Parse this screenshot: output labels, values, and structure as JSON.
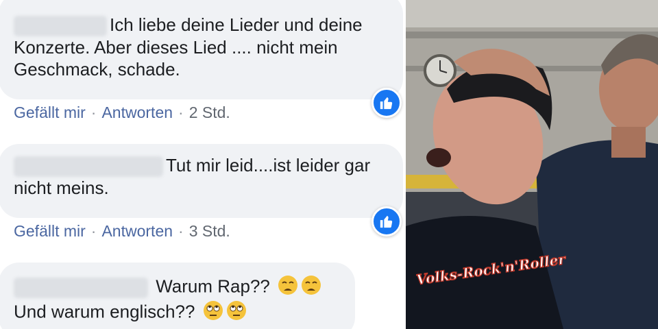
{
  "comments": [
    {
      "text_line1": "Ich liebe deine Lieder und deine",
      "text_line2": "Konzerte. Aber dieses Lied .... nicht mein",
      "text_line3": "Geschmack, schade."
    },
    {
      "text_line1": "Tut mir leid....ist leider gar",
      "text_line2": "nicht meins."
    },
    {
      "text_line1": "Warum Rap??",
      "text_line2": "Und warum englisch??"
    }
  ],
  "actions": [
    {
      "like": "Gefällt mir",
      "reply": "Antworten",
      "time": "2 Std."
    },
    {
      "like": "Gefällt mir",
      "reply": "Antworten",
      "time": "3 Std."
    }
  ],
  "shirt_print": "Volks-Rock'n'Roller",
  "colors": {
    "link": "#4b67a1",
    "bubble": "#f0f2f5",
    "like_badge": "#1877f2"
  }
}
